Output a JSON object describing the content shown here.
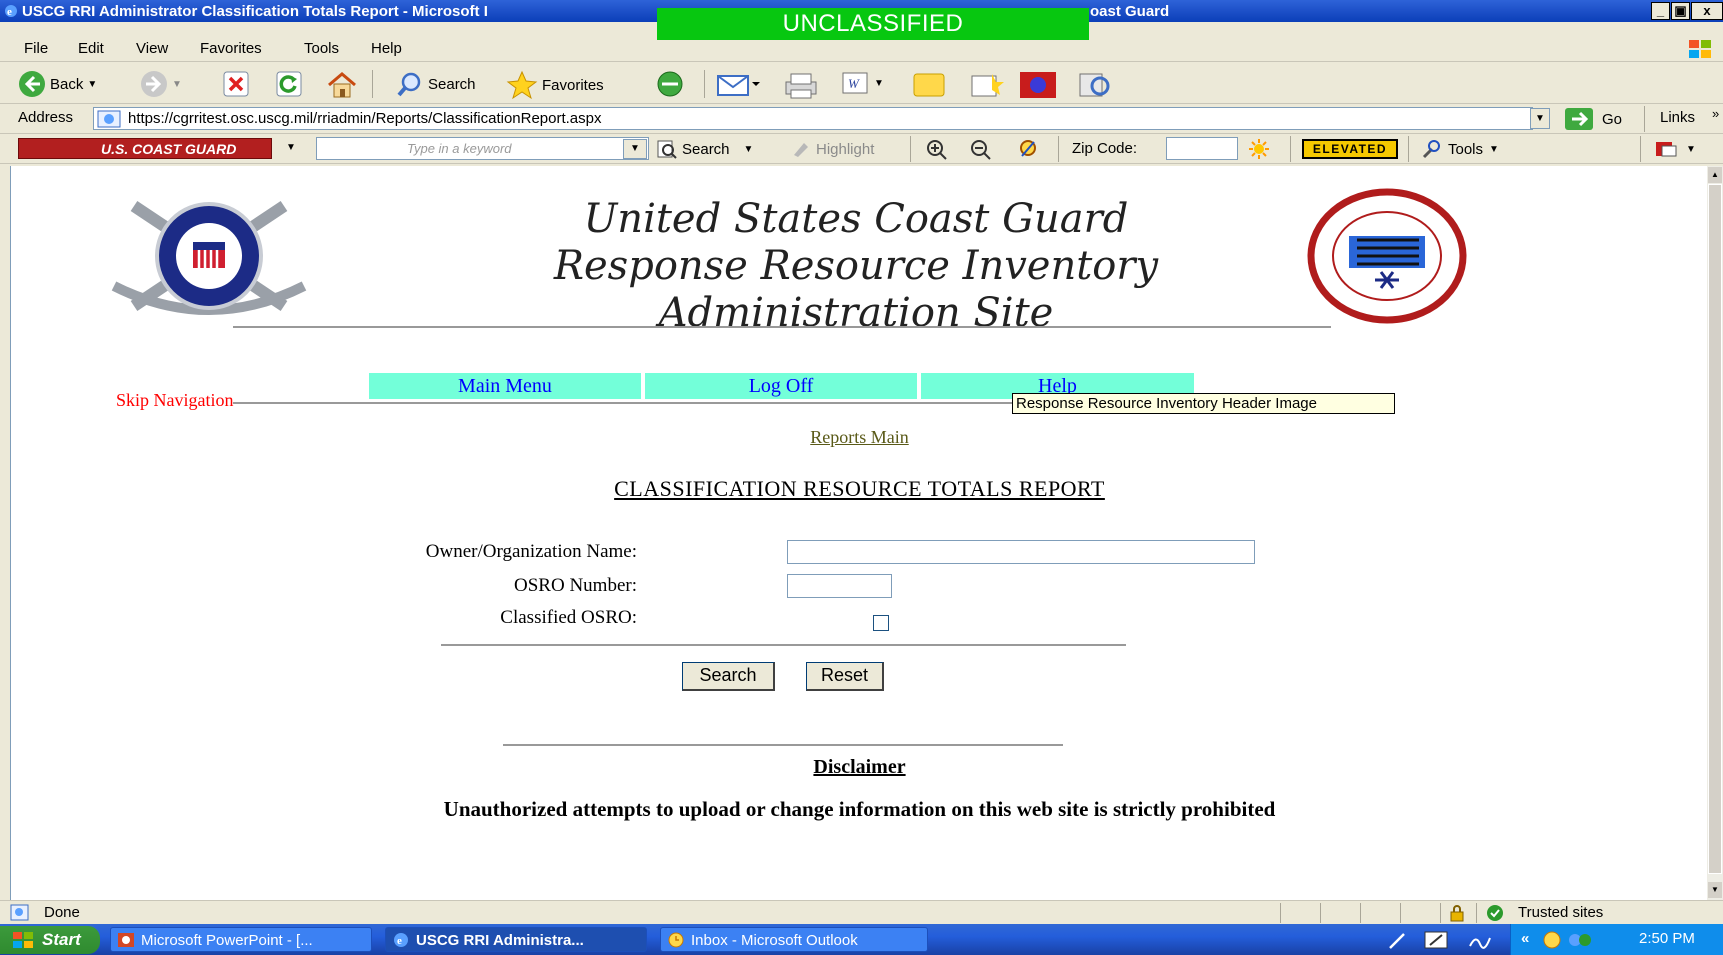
{
  "window": {
    "title": "USCG RRI Administrator Classification Totals Report - Microsoft I",
    "title_tail": "oast Guard",
    "classification_banner": "UNCLASSIFIED",
    "controls": [
      "_",
      "b",
      "x"
    ]
  },
  "menu": {
    "items": [
      "File",
      "Edit",
      "View",
      "Favorites",
      "Tools",
      "Help"
    ]
  },
  "toolbar": {
    "back_label": "Back",
    "search_label": "Search",
    "favorites_label": "Favorites"
  },
  "addressbar": {
    "label": "Address",
    "url": "https://cgrritest.osc.uscg.mil/rriadmin/Reports/ClassificationReport.aspx",
    "go_label": "Go",
    "links_label": "Links"
  },
  "cgtoolbar": {
    "logo_text": "U.S. COAST GUARD",
    "keyword_placeholder": "Type in a keyword",
    "search_label": "Search",
    "highlight_label": "Highlight",
    "zip_label": "Zip Code:",
    "threat_level": "ELEVATED",
    "tools_label": "Tools"
  },
  "page": {
    "header_lines": [
      "United States Coast Guard",
      "Response Resource Inventory",
      "Administration Site"
    ],
    "nav": [
      "Main Menu",
      "Log Off",
      "Help"
    ],
    "tooltip": "Response Resource Inventory Header Image",
    "skip_nav": "Skip Navigation",
    "reports_main": "Reports Main",
    "report_title": "CLASSIFICATION RESOURCE TOTALS REPORT",
    "form": {
      "owner_label": "Owner/Organization Name:",
      "owner_value": "",
      "osro_label": "OSRO Number:",
      "osro_value": "",
      "classified_label": "Classified OSRO:",
      "classified_checked": false
    },
    "search_button": "Search",
    "reset_button": "Reset",
    "disclaimer_title": "Disclaimer",
    "disclaimer_text": "Unauthorized attempts to upload or change information on this web site is strictly prohibited"
  },
  "statusbar": {
    "status": "Done",
    "zone": "Trusted sites"
  },
  "taskbar": {
    "start_label": "Start",
    "tasks": [
      "Microsoft PowerPoint - [...",
      "USCG RRI Administra...",
      "Inbox - Microsoft Outlook"
    ],
    "active_task": 1,
    "clock": "2:50 PM"
  },
  "colors": {
    "classification_banner": "#07c710",
    "nav_cell": "#73ffd9",
    "link_blue": "#0000ff",
    "skip_nav_red": "#ff0000",
    "threat_elevated": "#f5c800"
  }
}
